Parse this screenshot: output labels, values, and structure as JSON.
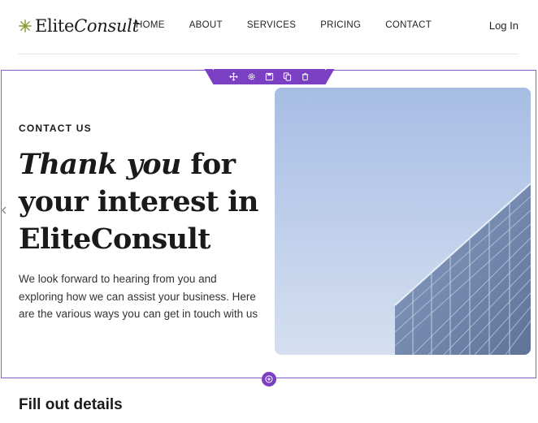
{
  "brand": {
    "name_regular": "Elite",
    "name_italic": "Consult",
    "icon": "sparkle-logo-icon",
    "icon_color": "#8a9a3a"
  },
  "nav": {
    "items": [
      {
        "label": "HOME"
      },
      {
        "label": "ABOUT"
      },
      {
        "label": "SERVICES"
      },
      {
        "label": "PRICING"
      },
      {
        "label": "CONTACT"
      }
    ],
    "login": "Log In"
  },
  "toolbar": {
    "accent": "#7b3fc4",
    "buttons": [
      "move-icon",
      "settings-icon",
      "save-icon",
      "duplicate-icon",
      "delete-icon"
    ]
  },
  "hero": {
    "eyebrow": "CONTACT US",
    "headline_italic": "Thank you",
    "headline_rest_1": " for",
    "headline_rest_2": "your interest in",
    "headline_rest_3": "EliteConsult",
    "description": "We look forward to hearing from you and exploring how we can assist your business. Here are the various ways you can get in touch with us",
    "image": "glass-office-building-image"
  },
  "section_add": "add-section-icon",
  "next_section": {
    "heading": "Fill out details"
  }
}
